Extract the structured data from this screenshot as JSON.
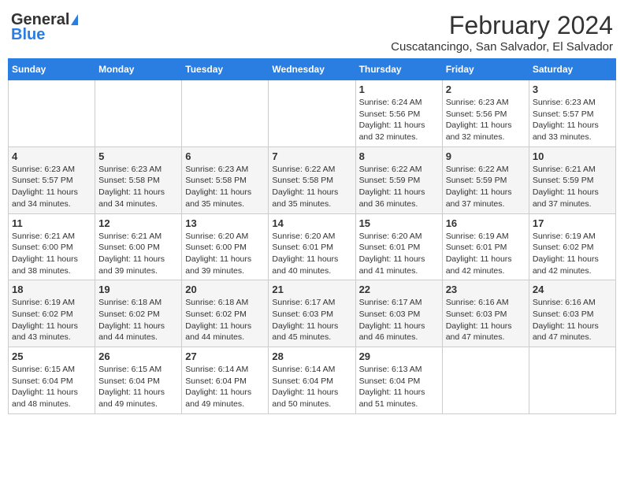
{
  "header": {
    "logo_general": "General",
    "logo_blue": "Blue",
    "month_year": "February 2024",
    "location": "Cuscatancingo, San Salvador, El Salvador"
  },
  "days_of_week": [
    "Sunday",
    "Monday",
    "Tuesday",
    "Wednesday",
    "Thursday",
    "Friday",
    "Saturday"
  ],
  "weeks": [
    [
      {
        "day": "",
        "info": ""
      },
      {
        "day": "",
        "info": ""
      },
      {
        "day": "",
        "info": ""
      },
      {
        "day": "",
        "info": ""
      },
      {
        "day": "1",
        "info": "Sunrise: 6:24 AM\nSunset: 5:56 PM\nDaylight: 11 hours\nand 32 minutes."
      },
      {
        "day": "2",
        "info": "Sunrise: 6:23 AM\nSunset: 5:56 PM\nDaylight: 11 hours\nand 32 minutes."
      },
      {
        "day": "3",
        "info": "Sunrise: 6:23 AM\nSunset: 5:57 PM\nDaylight: 11 hours\nand 33 minutes."
      }
    ],
    [
      {
        "day": "4",
        "info": "Sunrise: 6:23 AM\nSunset: 5:57 PM\nDaylight: 11 hours\nand 34 minutes."
      },
      {
        "day": "5",
        "info": "Sunrise: 6:23 AM\nSunset: 5:58 PM\nDaylight: 11 hours\nand 34 minutes."
      },
      {
        "day": "6",
        "info": "Sunrise: 6:23 AM\nSunset: 5:58 PM\nDaylight: 11 hours\nand 35 minutes."
      },
      {
        "day": "7",
        "info": "Sunrise: 6:22 AM\nSunset: 5:58 PM\nDaylight: 11 hours\nand 35 minutes."
      },
      {
        "day": "8",
        "info": "Sunrise: 6:22 AM\nSunset: 5:59 PM\nDaylight: 11 hours\nand 36 minutes."
      },
      {
        "day": "9",
        "info": "Sunrise: 6:22 AM\nSunset: 5:59 PM\nDaylight: 11 hours\nand 37 minutes."
      },
      {
        "day": "10",
        "info": "Sunrise: 6:21 AM\nSunset: 5:59 PM\nDaylight: 11 hours\nand 37 minutes."
      }
    ],
    [
      {
        "day": "11",
        "info": "Sunrise: 6:21 AM\nSunset: 6:00 PM\nDaylight: 11 hours\nand 38 minutes."
      },
      {
        "day": "12",
        "info": "Sunrise: 6:21 AM\nSunset: 6:00 PM\nDaylight: 11 hours\nand 39 minutes."
      },
      {
        "day": "13",
        "info": "Sunrise: 6:20 AM\nSunset: 6:00 PM\nDaylight: 11 hours\nand 39 minutes."
      },
      {
        "day": "14",
        "info": "Sunrise: 6:20 AM\nSunset: 6:01 PM\nDaylight: 11 hours\nand 40 minutes."
      },
      {
        "day": "15",
        "info": "Sunrise: 6:20 AM\nSunset: 6:01 PM\nDaylight: 11 hours\nand 41 minutes."
      },
      {
        "day": "16",
        "info": "Sunrise: 6:19 AM\nSunset: 6:01 PM\nDaylight: 11 hours\nand 42 minutes."
      },
      {
        "day": "17",
        "info": "Sunrise: 6:19 AM\nSunset: 6:02 PM\nDaylight: 11 hours\nand 42 minutes."
      }
    ],
    [
      {
        "day": "18",
        "info": "Sunrise: 6:19 AM\nSunset: 6:02 PM\nDaylight: 11 hours\nand 43 minutes."
      },
      {
        "day": "19",
        "info": "Sunrise: 6:18 AM\nSunset: 6:02 PM\nDaylight: 11 hours\nand 44 minutes."
      },
      {
        "day": "20",
        "info": "Sunrise: 6:18 AM\nSunset: 6:02 PM\nDaylight: 11 hours\nand 44 minutes."
      },
      {
        "day": "21",
        "info": "Sunrise: 6:17 AM\nSunset: 6:03 PM\nDaylight: 11 hours\nand 45 minutes."
      },
      {
        "day": "22",
        "info": "Sunrise: 6:17 AM\nSunset: 6:03 PM\nDaylight: 11 hours\nand 46 minutes."
      },
      {
        "day": "23",
        "info": "Sunrise: 6:16 AM\nSunset: 6:03 PM\nDaylight: 11 hours\nand 47 minutes."
      },
      {
        "day": "24",
        "info": "Sunrise: 6:16 AM\nSunset: 6:03 PM\nDaylight: 11 hours\nand 47 minutes."
      }
    ],
    [
      {
        "day": "25",
        "info": "Sunrise: 6:15 AM\nSunset: 6:04 PM\nDaylight: 11 hours\nand 48 minutes."
      },
      {
        "day": "26",
        "info": "Sunrise: 6:15 AM\nSunset: 6:04 PM\nDaylight: 11 hours\nand 49 minutes."
      },
      {
        "day": "27",
        "info": "Sunrise: 6:14 AM\nSunset: 6:04 PM\nDaylight: 11 hours\nand 49 minutes."
      },
      {
        "day": "28",
        "info": "Sunrise: 6:14 AM\nSunset: 6:04 PM\nDaylight: 11 hours\nand 50 minutes."
      },
      {
        "day": "29",
        "info": "Sunrise: 6:13 AM\nSunset: 6:04 PM\nDaylight: 11 hours\nand 51 minutes."
      },
      {
        "day": "",
        "info": ""
      },
      {
        "day": "",
        "info": ""
      }
    ]
  ]
}
